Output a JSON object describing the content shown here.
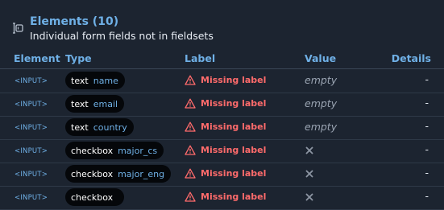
{
  "section": {
    "title": "Elements (10)",
    "subtitle": "Individual form fields not in fieldsets"
  },
  "columns": {
    "element": "Element",
    "type": "Type",
    "label": "Label",
    "value": "Value",
    "details": "Details"
  },
  "rows": [
    {
      "element": "<INPUT>",
      "type": "text",
      "name": "name",
      "label": "Missing label",
      "value": "empty",
      "value_kind": "text",
      "details": "-"
    },
    {
      "element": "<INPUT>",
      "type": "text",
      "name": "email",
      "label": "Missing label",
      "value": "empty",
      "value_kind": "text",
      "details": "-"
    },
    {
      "element": "<INPUT>",
      "type": "text",
      "name": "country",
      "label": "Missing label",
      "value": "empty",
      "value_kind": "text",
      "details": "-"
    },
    {
      "element": "<INPUT>",
      "type": "checkbox",
      "name": "major_cs",
      "label": "Missing label",
      "value": "",
      "value_kind": "unchecked-x-icon",
      "details": "-"
    },
    {
      "element": "<INPUT>",
      "type": "checkbox",
      "name": "major_eng",
      "label": "Missing label",
      "value": "",
      "value_kind": "unchecked-x-icon",
      "details": "-"
    },
    {
      "element": "<INPUT>",
      "type": "checkbox",
      "name": "",
      "label": "Missing label",
      "value": "",
      "value_kind": "unchecked-x-icon",
      "details": "-"
    }
  ],
  "colors": {
    "background": "#1c2430",
    "accent": "#6fb0e6",
    "error": "#ff6b6b",
    "muted": "#9aa4b2",
    "pill": "#05070a"
  },
  "icons": {
    "header": "form-field-icon",
    "warning": "warning-triangle-icon",
    "unchecked": "x-icon"
  }
}
